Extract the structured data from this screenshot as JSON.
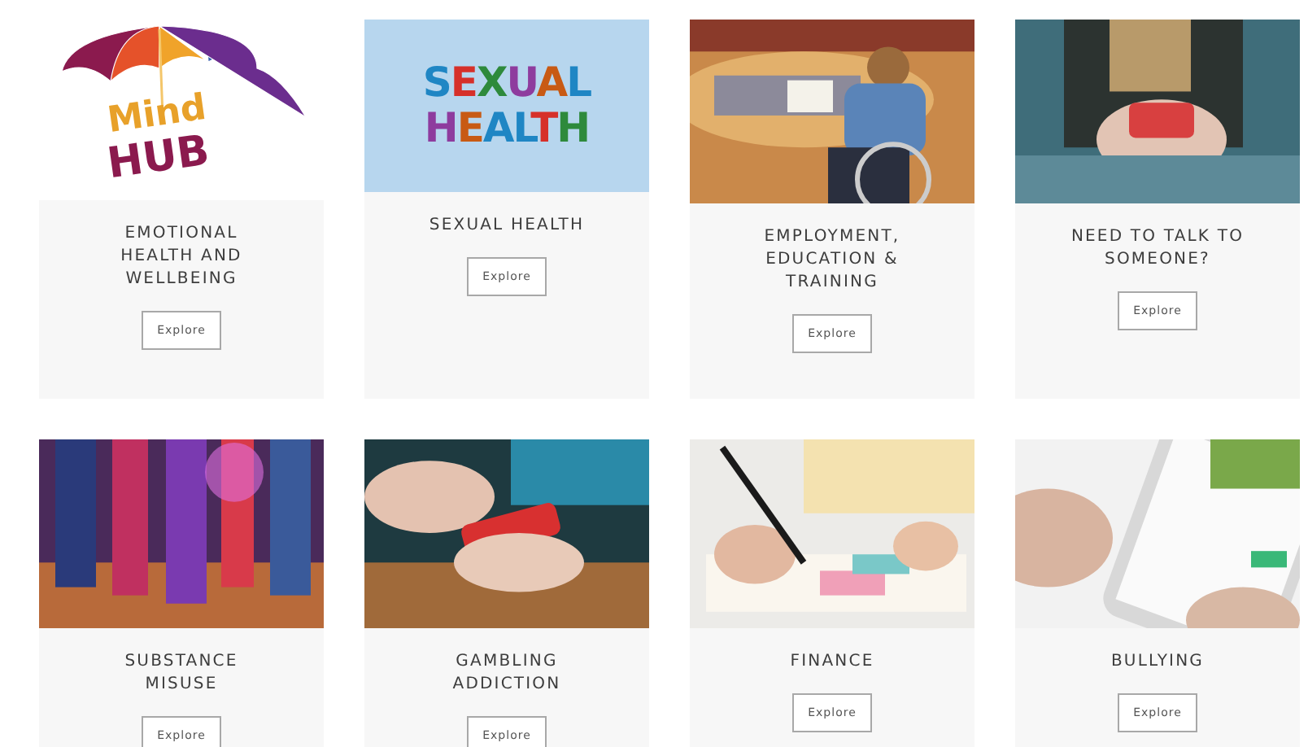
{
  "cards": [
    {
      "title": "EMOTIONAL HEALTH AND WELLBEING",
      "button": "Explore",
      "image": {
        "kind": "logo",
        "lines": [
          "Mind",
          "HUB"
        ]
      }
    },
    {
      "title": "SEXUAL HEALTH",
      "button": "Explore",
      "image": {
        "kind": "banner",
        "lines": [
          "SEXUAL",
          "HEALTH"
        ]
      }
    },
    {
      "title": "EMPLOYMENT, EDUCATION & TRAINING",
      "button": "Explore"
    },
    {
      "title": "NEED TO TALK TO SOMEONE?",
      "button": "Explore"
    },
    {
      "title": "SUBSTANCE MISUSE",
      "button": "Explore"
    },
    {
      "title": "GAMBLING ADDICTION",
      "button": "Explore"
    },
    {
      "title": "FINANCE",
      "button": "Explore"
    },
    {
      "title": "BULLYING",
      "button": "Explore"
    }
  ]
}
